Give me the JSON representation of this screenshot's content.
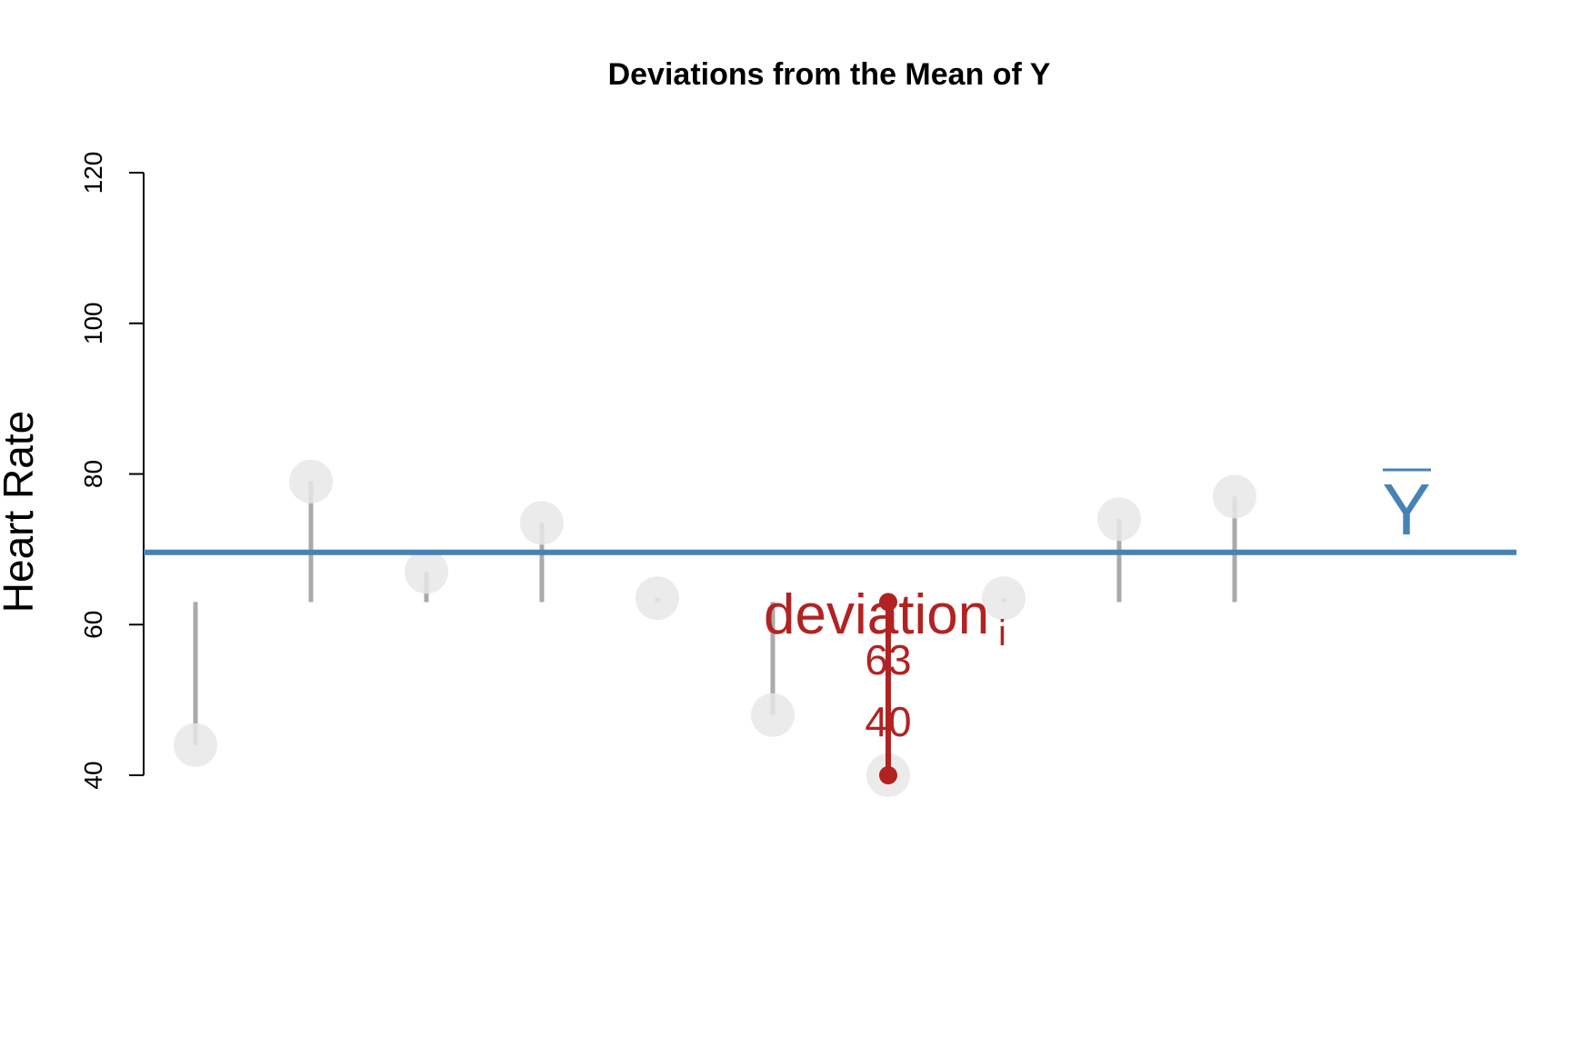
{
  "chart_data": {
    "type": "scatter",
    "title": "Deviations from the Mean of Y",
    "xlabel": "",
    "ylabel": "Heart Rate",
    "ylim": [
      40,
      120
    ],
    "y_ticks": [
      "40",
      "60",
      "80",
      "100",
      "120"
    ],
    "x": [
      1,
      2,
      3,
      4,
      5,
      6,
      7,
      8,
      9,
      10
    ],
    "values": [
      44,
      79,
      67,
      73.5,
      63.5,
      48,
      40,
      63.5,
      74,
      77
    ],
    "mean": 69.6,
    "deviation_baseline": 63,
    "mean_label": "Y",
    "highlight": {
      "index": 6,
      "label": "deviation",
      "subscript": "i",
      "top_value_label": "63",
      "bottom_value_label": "40"
    },
    "colors": {
      "points": "#e8e8e8",
      "segments": "#aaaaaa",
      "mean_line": "#4682b4",
      "highlight": "#b22222"
    }
  }
}
